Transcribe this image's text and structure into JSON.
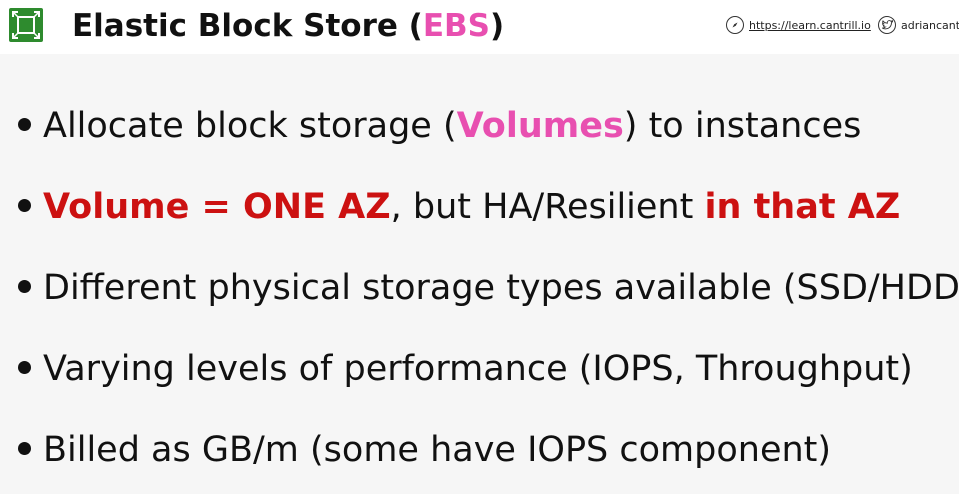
{
  "header": {
    "logo_icon": "aws-resource-icon",
    "logo_color": "#2e8b2e",
    "title_main": "Elastic Block Store (",
    "title_accent": "EBS",
    "title_close": ")",
    "website_icon": "compass-icon",
    "website_text": "https://learn.cantrill.io",
    "social_icon": "twitter-icon",
    "social_text": "adriancantr"
  },
  "colors": {
    "accent_pink": "#e84fb0",
    "accent_red": "#cc1111"
  },
  "bullets": [
    {
      "pre": "Allocate block storage (",
      "em": "Volumes",
      "post": ") to instances"
    },
    {
      "em1": "Volume = ONE AZ",
      "mid": ", but HA/Resilient ",
      "em2": "in that AZ"
    },
    {
      "text": "Different physical storage types available (SSD/HDD)"
    },
    {
      "text": "Varying levels of performance (IOPS, Throughput)"
    },
    {
      "text": "Billed as GB/m (some have IOPS component)"
    }
  ]
}
